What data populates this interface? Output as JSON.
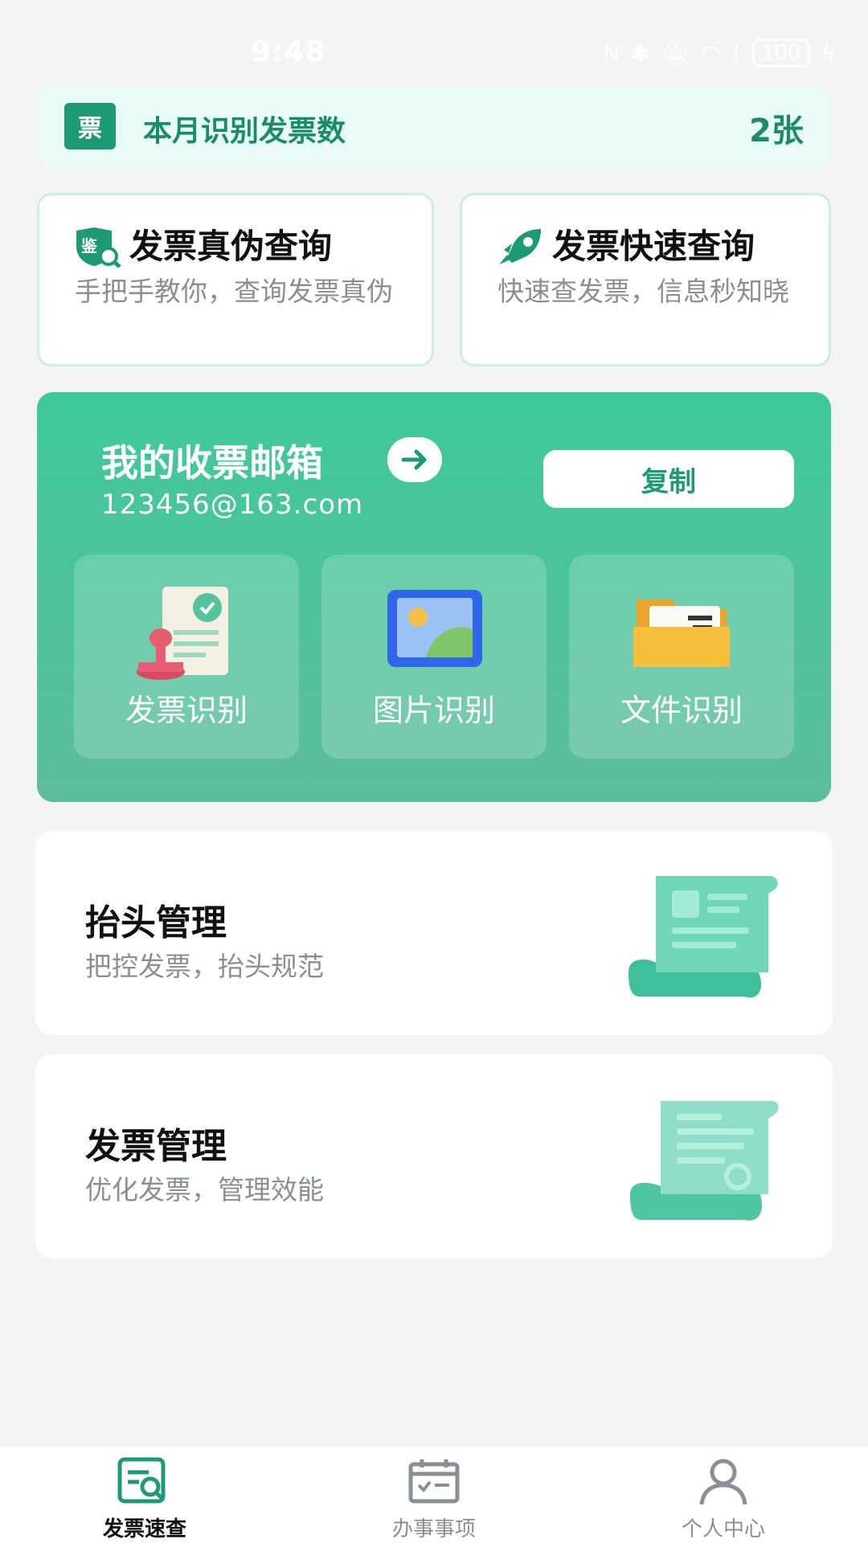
{
  "status_bar": {
    "time": "9:48",
    "battery": "100"
  },
  "banner": {
    "icon_char": "票",
    "title": "本月识别发票数",
    "count": "2张"
  },
  "quick_cards": [
    {
      "title": "发票真伪查询",
      "desc": "手把手教你，查询发票真伪",
      "icon": "verify-shield-icon"
    },
    {
      "title": "发票快速查询",
      "desc": "快速查发票，信息秒知晓",
      "icon": "rocket-icon"
    }
  ],
  "mailbox": {
    "title": "我的收票邮箱",
    "email": "123456@163.com",
    "copy_label": "复制"
  },
  "tiles": [
    {
      "label": "发票识别",
      "icon": "invoice-stamp-icon"
    },
    {
      "label": "图片识别",
      "icon": "picture-icon"
    },
    {
      "label": "文件识别",
      "icon": "folder-icon"
    }
  ],
  "management": [
    {
      "title": "抬头管理",
      "desc": "把控发票，抬头规范",
      "icon": "header-scroll-icon"
    },
    {
      "title": "发票管理",
      "desc": "优化发票，管理效能",
      "icon": "invoice-scroll-icon"
    }
  ],
  "nav": [
    {
      "label": "发票速查",
      "icon": "invoice-search-icon",
      "active": true
    },
    {
      "label": "办事事项",
      "icon": "calendar-check-icon",
      "active": false
    },
    {
      "label": "个人中心",
      "icon": "person-icon",
      "active": false
    }
  ],
  "colors": {
    "accent": "#1d9a74",
    "panel_top": "#3ec99a",
    "panel_bottom": "#5dbd9b",
    "banner_bg": "#e9fbf6"
  }
}
